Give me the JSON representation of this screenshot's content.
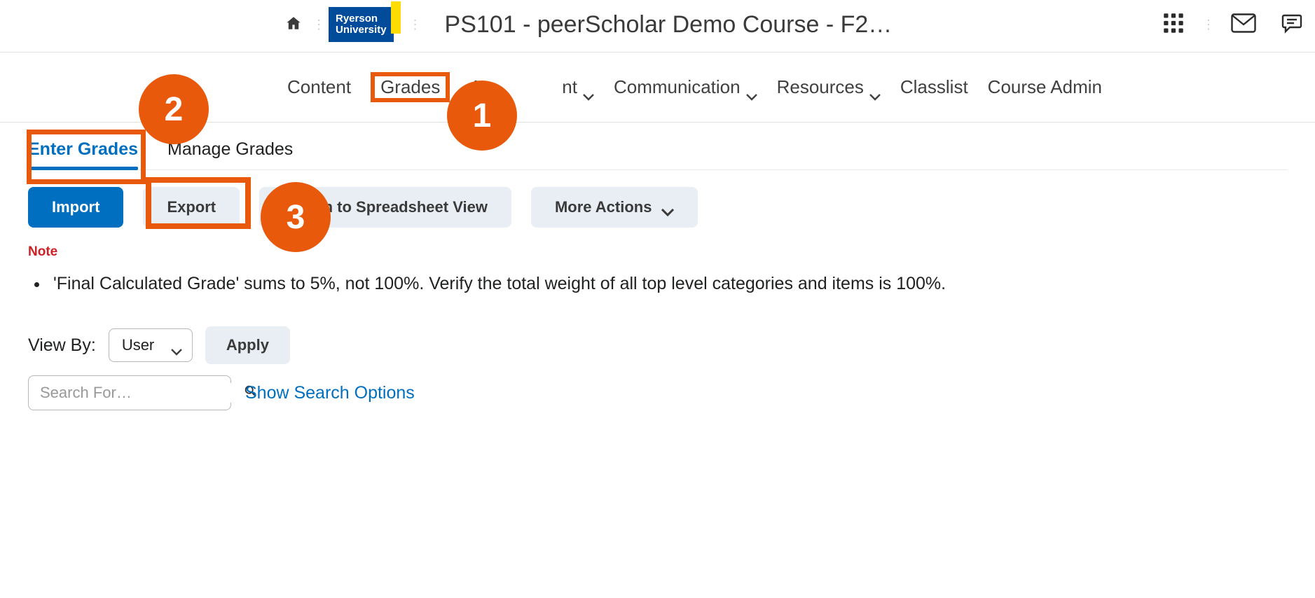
{
  "brand": {
    "line1": "Ryerson",
    "line2": "University"
  },
  "header": {
    "course_title": "PS101 - peerScholar Demo Course - F20…"
  },
  "nav": {
    "content": "Content",
    "grades": "Grades",
    "assessment_prefix": "A",
    "assessment_suffix": "nt",
    "communication": "Communication",
    "resources": "Resources",
    "classlist": "Classlist",
    "course_admin": "Course Admin"
  },
  "subtabs": {
    "enter_grades": "Enter Grades",
    "manage_grades": "Manage Grades"
  },
  "actions": {
    "import": "Import",
    "export": "Export",
    "switch_view": "Switch to Spreadsheet View",
    "more_actions": "More Actions"
  },
  "note": {
    "label": "Note",
    "items": [
      "'Final Calculated Grade' sums to 5%, not 100%. Verify the total weight of all top level categories and items is 100%."
    ]
  },
  "view": {
    "label": "View By:",
    "selected": "User",
    "apply": "Apply"
  },
  "search": {
    "placeholder": "Search For…",
    "show_options": "Show Search Options"
  },
  "callouts": {
    "c1": "1",
    "c2": "2",
    "c3": "3"
  }
}
